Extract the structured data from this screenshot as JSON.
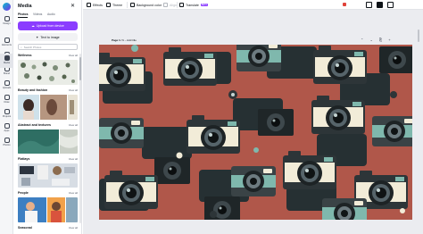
{
  "rail": {
    "items": [
      {
        "label": "Design"
      },
      {
        "label": "Elements"
      },
      {
        "label": "Text"
      },
      {
        "label": "Brand"
      },
      {
        "label": "Uploads"
      },
      {
        "label": "Draw"
      },
      {
        "label": "Projects"
      },
      {
        "label": "Apps"
      },
      {
        "label": "Media"
      },
      {
        "label": "Photos"
      }
    ]
  },
  "panel": {
    "title": "Media",
    "tabs": [
      "Photos",
      "Videos",
      "Audio"
    ],
    "upload_label": "Upload from device",
    "text_to_image_label": "Text to image",
    "search_placeholder": "Search Photos",
    "sections": [
      {
        "title": "Wellness",
        "view_all": "View all"
      },
      {
        "title": "Beauty and fashion",
        "view_all": "View all"
      },
      {
        "title": "Abstract and textures",
        "view_all": "View all"
      },
      {
        "title": "Flatlays",
        "view_all": "View all"
      },
      {
        "title": "People",
        "view_all": "View all"
      },
      {
        "title": "Seasonal",
        "view_all": "View all"
      }
    ]
  },
  "toolbar": {
    "items": [
      "Effects",
      "Theme",
      "Background color",
      "Align",
      "Translate"
    ],
    "beta": "BETA"
  },
  "canvas": {
    "page_prefix": "Page 1 / 1",
    "page_title": "– Add title",
    "page_actions": "⌃ ⌄ ⎘ +"
  },
  "colors": {
    "accent": "#8b3dff",
    "design_background": "#b0574a",
    "camera_dark": "#2d3538",
    "camera_cream": "#f2ecd8",
    "camera_teal": "#7fb8ad"
  }
}
